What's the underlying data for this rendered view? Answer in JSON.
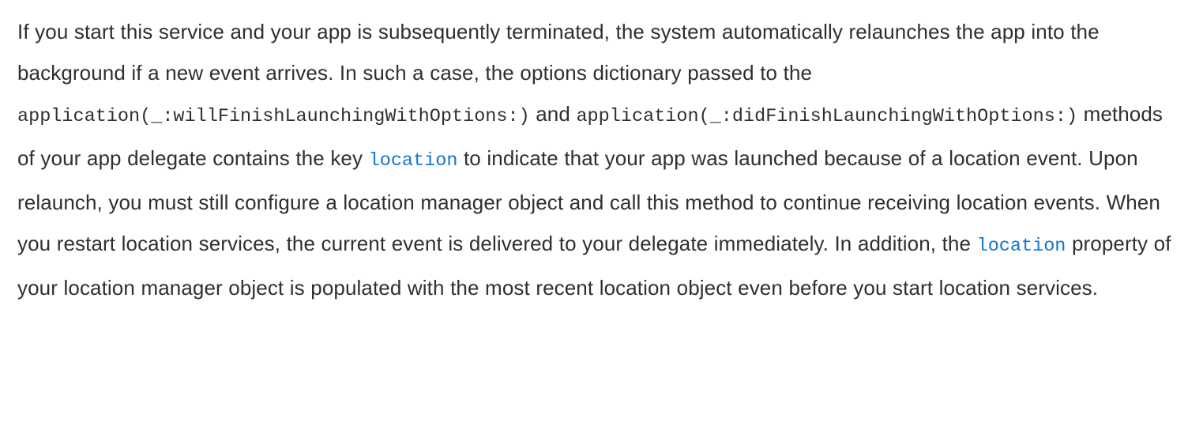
{
  "document": {
    "type": "api-reference-paragraph",
    "colors": {
      "background": "#ffffff",
      "body_text": "#2f2f2f",
      "code_link": "#1175d1"
    },
    "paragraph": {
      "segment_1": "If you start this service and your app is subsequently terminated, the system automatically relaunches the app into the background if a new event arrives. In such a case, the options dictionary passed to the ",
      "code_1": "application(_:willFinishLaunchingWithOptions:)",
      "segment_2": " and ",
      "code_2": "application(_:didFinishLaunchingWithOptions:)",
      "segment_3": " methods of your app delegate contains the key ",
      "link_1": "location",
      "segment_4": " to indicate that your app was launched because of a location event. Upon relaunch, you must still configure a location manager object and call this method to continue receiving location events. When you restart location services, the current event is delivered to your delegate immediately. In addition, the ",
      "link_2": "location",
      "segment_5": " property of your location manager object is populated with the most recent location object even before you start location services."
    }
  }
}
